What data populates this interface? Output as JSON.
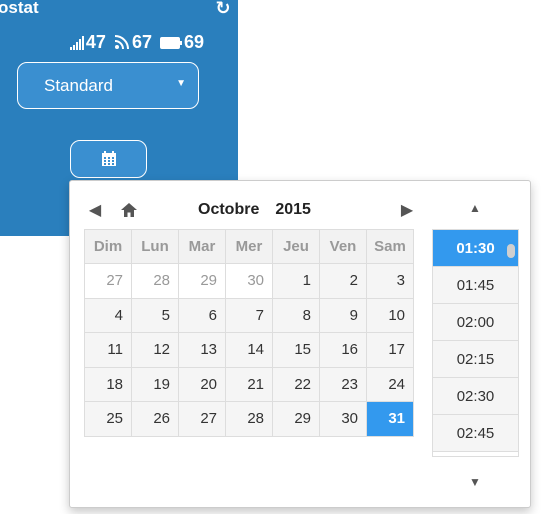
{
  "widget": {
    "title": "ostat",
    "status": {
      "signal_value": "47",
      "wifi_value": "67",
      "battery_value": "69"
    },
    "mode_select": {
      "value": "Standard"
    }
  },
  "picker": {
    "month": "Octobre",
    "year": "2015",
    "weekdays": [
      "Dim",
      "Lun",
      "Mar",
      "Mer",
      "Jeu",
      "Ven",
      "Sam"
    ],
    "weeks": [
      [
        "27",
        "28",
        "29",
        "30",
        "1",
        "2",
        "3"
      ],
      [
        "4",
        "5",
        "6",
        "7",
        "8",
        "9",
        "10"
      ],
      [
        "11",
        "12",
        "13",
        "14",
        "15",
        "16",
        "17"
      ],
      [
        "18",
        "19",
        "20",
        "21",
        "22",
        "23",
        "24"
      ],
      [
        "25",
        "26",
        "27",
        "28",
        "29",
        "30",
        "31"
      ]
    ],
    "selected_day": "31",
    "times": [
      "01:30",
      "01:45",
      "02:00",
      "02:15",
      "02:30",
      "02:45"
    ],
    "selected_time": "01:30"
  }
}
